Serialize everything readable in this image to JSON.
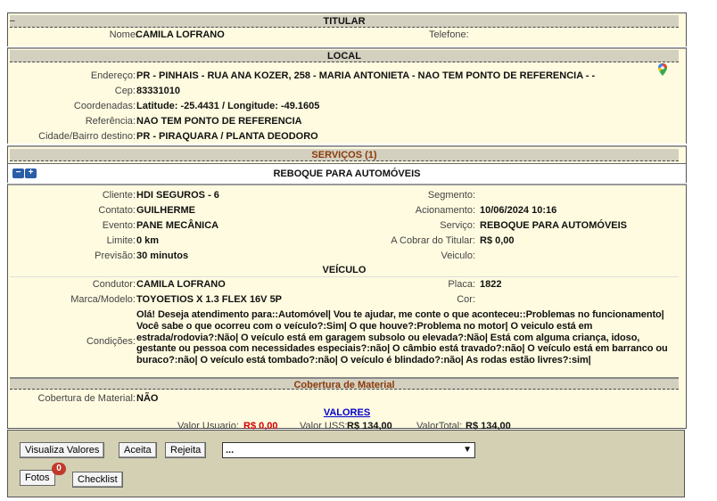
{
  "titular": {
    "header": "TITULAR",
    "collapse": "–",
    "nome_label": "Nome:",
    "nome": "CAMILA LOFRANO",
    "telefone_label": "Telefone:",
    "telefone": ""
  },
  "local": {
    "header": "LOCAL",
    "endereco_label": "Endereço:",
    "endereco": "PR - PINHAIS - RUA   ANA KOZER, 258  - MARIA ANTONIETA -  NAO TEM PONTO DE REFERENCIA  -   -",
    "cep_label": "Cep:",
    "cep": "83331010",
    "coord_label": "Coordenadas:",
    "coord": "Latitude: -25.4431 / Longitude: -49.1605",
    "ref_label": "Referência:",
    "ref": "NAO TEM PONTO DE REFERENCIA",
    "cidade_label": "Cidade/Bairro destino:",
    "cidade": "PR - PIRAQUARA / PLANTA DEODORO"
  },
  "servicos": {
    "header": "SERVIÇOS (1)",
    "toggle_minus": "−",
    "toggle_plus": "+",
    "service_title": "REBOQUE PARA AUTOMÓVEIS"
  },
  "detalhe": {
    "cliente_label": "Cliente:",
    "cliente": "HDI SEGUROS - 6",
    "segmento_label": "Segmento:",
    "segmento": "",
    "contato_label": "Contato:",
    "contato": "GUILHERME",
    "acionamento_label": "Acionamento:",
    "acionamento": "10/06/2024 10:16",
    "evento_label": "Evento:",
    "evento": "PANE MECÂNICA",
    "servico_label": "Serviço:",
    "servico": "REBOQUE PARA AUTOMÓVEIS",
    "limite_label": "Limite:",
    "limite": "0 km",
    "cobrar_label": "A Cobrar do Titular:",
    "cobrar": "R$ 0,00",
    "previsao_label": "Previsão:",
    "previsao": "30  minutos",
    "veiculo_label": "Veiculo:",
    "veiculo": ""
  },
  "veiculo": {
    "header": "VEÍCULO",
    "condutor_label": "Condutor:",
    "condutor": "CAMILA LOFRANO",
    "placa_label": "Placa:",
    "placa": "1822",
    "marca_label": "Marca/Modelo:",
    "marca": "TOYOETIOS X 1.3 FLEX 16V 5P",
    "cor_label": "Cor:",
    "cor": "",
    "condicoes_label": "Condições:",
    "condicoes": "Olá! Deseja atendimento para::Automóvel| Vou te ajudar, me conte o que aconteceu::Problemas no funcionamento| Você sabe o que ocorreu com o veículo?:Sim| O que houve?:Problema no motor| O veiculo está em estrada/rodovia?:Não| O veículo está em garagem subsolo ou elevada?:Não| Está com alguma criança, idoso, gestante ou pessoa com necessidades especiais?:não| O câmbio está travado?:não| O veículo está em barranco ou buraco?:não| O veículo está tombado?:não| O veículo é blindado?:não| As rodas estão livres?:sim|"
  },
  "cobertura": {
    "header": "Cobertura de Material",
    "label": "Cobertura de Material:",
    "value": "NÃO"
  },
  "valores": {
    "link": "VALORES",
    "usuario_label": "Valor Usuario:",
    "usuario": "R$ 0,00",
    "uss_label": "Valor USS:",
    "uss": "R$ 134,00",
    "total_label": "ValorTotal:",
    "total": "R$ 134,00"
  },
  "actions": {
    "visualiza": "Visualiza Valores",
    "aceita": "Aceita",
    "rejeita": "Rejeita",
    "select_value": "...",
    "fotos": "Fotos",
    "fotos_count": "0",
    "checklist": "Checklist"
  },
  "colors": {
    "panel_bg": "#fffbe0",
    "header_bg": "#d4d0c0",
    "brown": "#8b3a0a",
    "red": "#d00000",
    "link": "#0000cc"
  }
}
